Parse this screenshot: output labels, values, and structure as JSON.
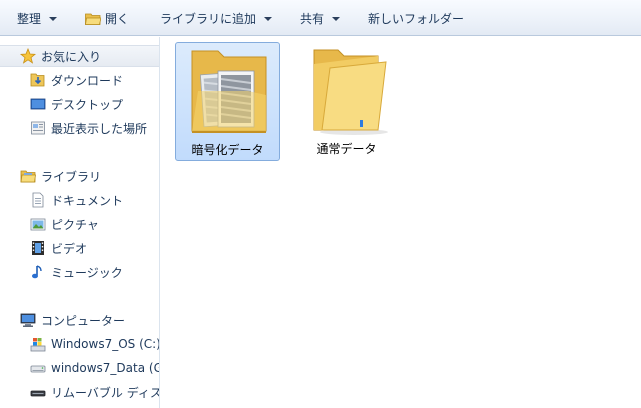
{
  "toolbar": {
    "organize": "整理",
    "open": "開く",
    "add_to_library": "ライブラリに追加",
    "share": "共有",
    "new_folder": "新しいフォルダー"
  },
  "nav": {
    "favorites": "お気に入り",
    "favorites_items": [
      "ダウンロード",
      "デスクトップ",
      "最近表示した場所"
    ],
    "libraries": "ライブラリ",
    "libraries_items": [
      "ドキュメント",
      "ピクチャ",
      "ビデオ",
      "ミュージック"
    ],
    "computer": "コンピューター",
    "computer_items": [
      "Windows7_OS (C:)",
      "windows7_Data (G",
      "リムーバブル ディス"
    ]
  },
  "folders": [
    {
      "name": "暗号化データ",
      "selected": true,
      "icon": "encrypted-folder-icon"
    },
    {
      "name": "通常データ",
      "selected": false,
      "icon": "folder-icon"
    }
  ],
  "colors": {
    "folder": "#f6d56e",
    "folder_dark": "#e7b84a",
    "selection": "#c9e0fc",
    "selection_border": "#84acdd",
    "text": "#1e395b"
  }
}
